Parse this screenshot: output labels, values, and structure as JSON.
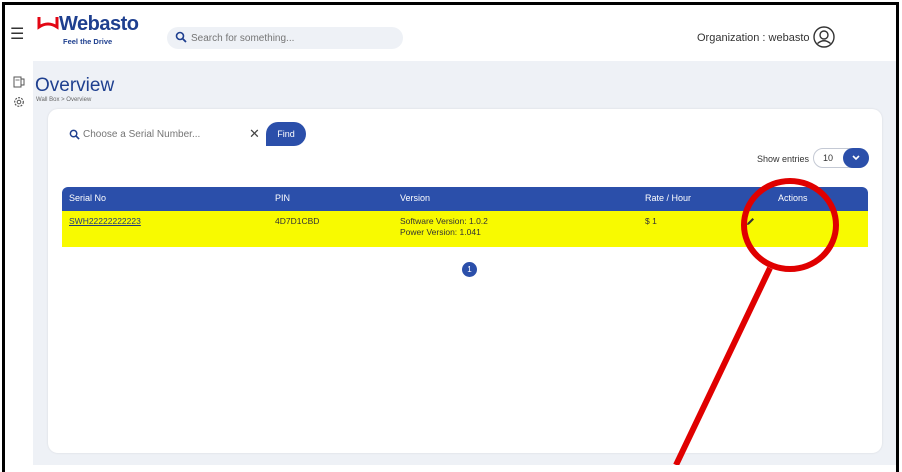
{
  "brand": {
    "name": "Webasto",
    "tagline": "Feel the Drive",
    "color": "#1e3f8f"
  },
  "header": {
    "search_placeholder": "Search for something...",
    "organization": "Organization : webasto"
  },
  "page": {
    "title": "Overview",
    "breadcrumb": "Wall Box > Overview"
  },
  "filter": {
    "serial_placeholder": "Choose a Serial Number...",
    "find_label": "Find",
    "show_entries_label": "Show entries",
    "entries_value": "10"
  },
  "table": {
    "headers": [
      "Serial No",
      "PIN",
      "Version",
      "Rate / Hour",
      "Actions"
    ],
    "rows": [
      {
        "serial": "SWH22222222223",
        "pin": "4D7D1CBD",
        "software_version": "Software Version: 1.0.2",
        "power_version": "Power Version: 1.041",
        "rate": "$ 1"
      }
    ]
  },
  "pagination": {
    "current": "1"
  },
  "colors": {
    "accent": "#2b4faa",
    "highlight": "#f8fa00",
    "annotation": "#e00000"
  },
  "icons": [
    "menu-icon",
    "search-icon",
    "user-avatar-icon",
    "devices-icon",
    "settings-icon",
    "close-icon",
    "chevron-down-icon",
    "pencil-icon"
  ]
}
